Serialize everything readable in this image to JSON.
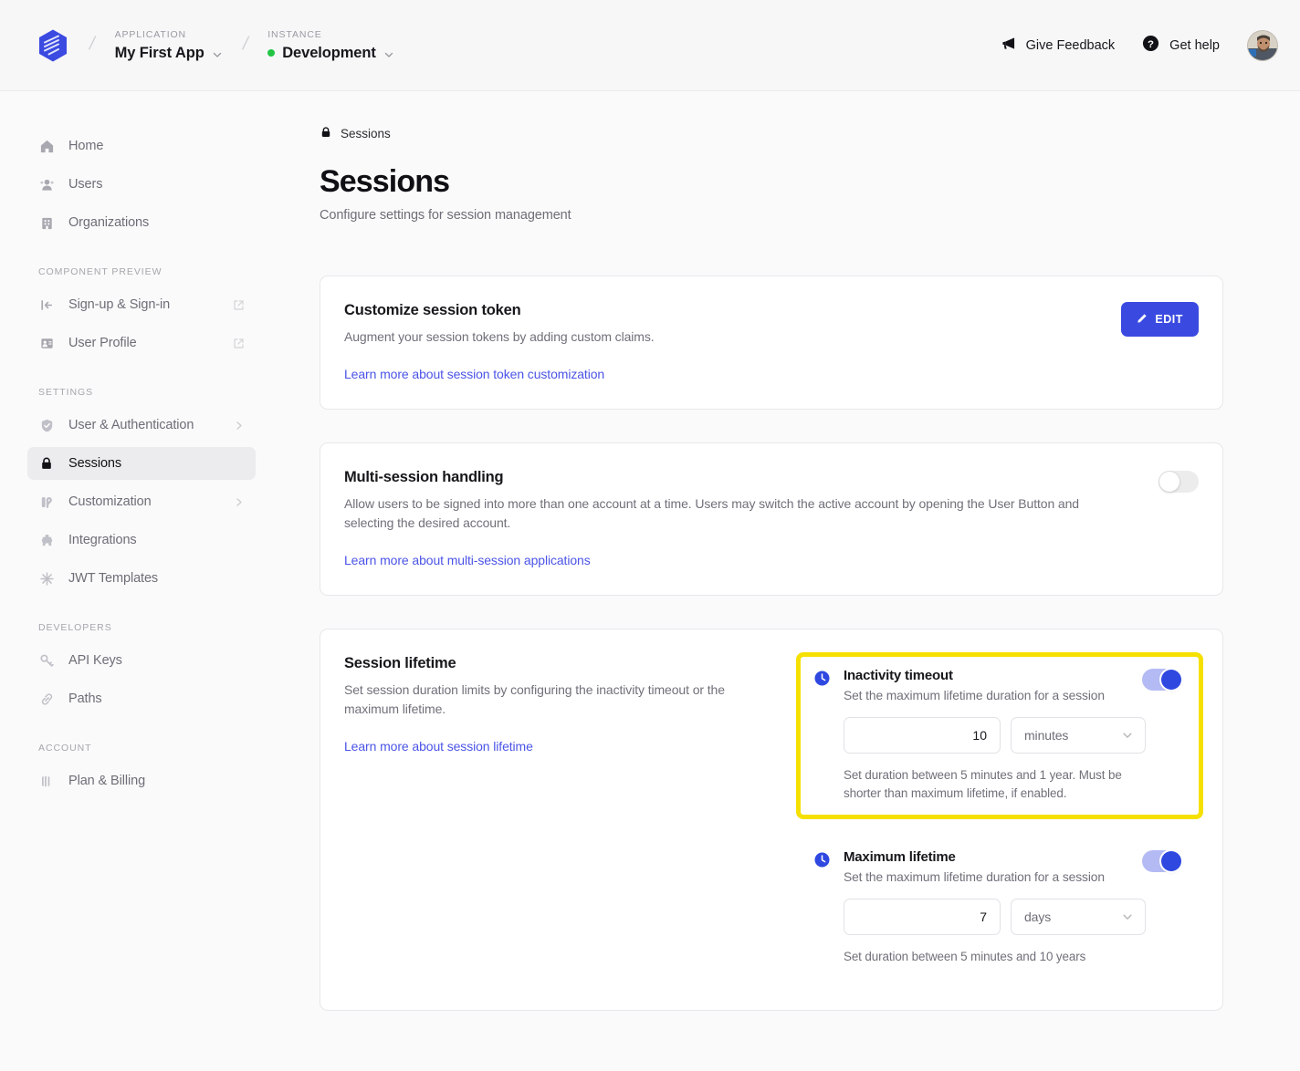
{
  "topbar": {
    "logo_name": "clerk-logo",
    "application": {
      "kicker": "APPLICATION",
      "value": "My First App"
    },
    "instance": {
      "kicker": "INSTANCE",
      "value": "Development",
      "status_color": "#22c543"
    },
    "give_feedback": "Give Feedback",
    "get_help": "Get help"
  },
  "sidebar": {
    "groups": [
      {
        "heading": "",
        "items": [
          {
            "label": "Home",
            "icon": "home-icon",
            "active": false,
            "external": false,
            "caret": false
          },
          {
            "label": "Users",
            "icon": "users-icon",
            "active": false,
            "external": false,
            "caret": false
          },
          {
            "label": "Organizations",
            "icon": "organizations-icon",
            "active": false,
            "external": false,
            "caret": false
          }
        ]
      },
      {
        "heading": "COMPONENT PREVIEW",
        "items": [
          {
            "label": "Sign-up & Sign-in",
            "icon": "sign-in-icon",
            "active": false,
            "external": true,
            "caret": false
          },
          {
            "label": "User Profile",
            "icon": "user-profile-icon",
            "active": false,
            "external": true,
            "caret": false
          }
        ]
      },
      {
        "heading": "SETTINGS",
        "items": [
          {
            "label": "User & Authentication",
            "icon": "shield-icon",
            "active": false,
            "external": false,
            "caret": true
          },
          {
            "label": "Sessions",
            "icon": "lock-icon",
            "active": true,
            "external": false,
            "caret": false
          },
          {
            "label": "Customization",
            "icon": "customization-icon",
            "active": false,
            "external": false,
            "caret": true
          },
          {
            "label": "Integrations",
            "icon": "puzzle-icon",
            "active": false,
            "external": false,
            "caret": false
          },
          {
            "label": "JWT Templates",
            "icon": "jwt-icon",
            "active": false,
            "external": false,
            "caret": false
          }
        ]
      },
      {
        "heading": "DEVELOPERS",
        "items": [
          {
            "label": "API Keys",
            "icon": "key-icon",
            "active": false,
            "external": false,
            "caret": false
          },
          {
            "label": "Paths",
            "icon": "link-icon",
            "active": false,
            "external": false,
            "caret": false
          }
        ]
      },
      {
        "heading": "ACCOUNT",
        "items": [
          {
            "label": "Plan & Billing",
            "icon": "billing-icon",
            "active": false,
            "external": false,
            "caret": false
          }
        ]
      }
    ]
  },
  "page": {
    "breadcrumb": "Sessions",
    "breadcrumb_icon": "lock-icon",
    "title": "Sessions",
    "subtitle": "Configure settings for session management"
  },
  "cards": {
    "session_token": {
      "title": "Customize session token",
      "description": "Augment your session tokens by adding custom claims.",
      "link": "Learn more about session token customization",
      "edit_button": "EDIT",
      "edit_icon": "pencil-icon"
    },
    "multi_session": {
      "title": "Multi-session handling",
      "description": "Allow users to be signed into more than one account at a time. Users may switch the active account by opening the User Button and selecting the desired account.",
      "link": "Learn more about multi-session applications",
      "toggle_state": "off"
    },
    "session_lifetime": {
      "title": "Session lifetime",
      "description": "Set session duration limits by configuring the inactivity timeout or the maximum lifetime.",
      "link": "Learn more about session lifetime",
      "options": [
        {
          "icon": "clock-icon",
          "title": "Inactivity timeout",
          "description": "Set the maximum lifetime duration for a session",
          "value": "10",
          "unit": "minutes",
          "hint": "Set duration between 5 minutes and 1 year. Must be shorter than maximum lifetime, if enabled.",
          "toggle_state": "on",
          "highlighted": true
        },
        {
          "icon": "clock-icon",
          "title": "Maximum lifetime",
          "description": "Set the maximum lifetime duration for a session",
          "value": "7",
          "unit": "days",
          "hint": "Set duration between 5 minutes and 10 years",
          "toggle_state": "on",
          "highlighted": false
        }
      ]
    }
  },
  "colors": {
    "brand_blue": "#3a4ae0",
    "link_blue": "#4b54e6",
    "highlight_yellow": "#f5e000",
    "status_green": "#22c543"
  }
}
